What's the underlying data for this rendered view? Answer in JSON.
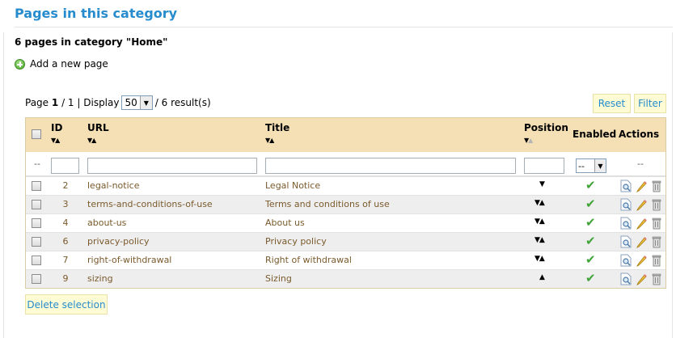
{
  "header": {
    "title": "Pages in this category",
    "count_text": "6 pages in category \"Home\"",
    "add_link": "Add a new page"
  },
  "pager": {
    "page_label": "Page",
    "page_current": "1",
    "page_total_text": "/ 1 | Display",
    "display_value": "50",
    "results_text": "/ 6 result(s)"
  },
  "toolbar": {
    "reset_label": "Reset",
    "filter_label": "Filter"
  },
  "columns": {
    "id": "ID",
    "url": "URL",
    "title": "Title",
    "position": "Position",
    "enabled": "Enabled",
    "actions": "Actions"
  },
  "filters": {
    "dash": "--",
    "enabled_value": "--",
    "actions_dash": "--"
  },
  "rows": [
    {
      "id": "2",
      "url": "legal-notice",
      "title": "Legal Notice",
      "position": "down",
      "enabled": true
    },
    {
      "id": "3",
      "url": "terms-and-conditions-of-use",
      "title": "Terms and conditions of use",
      "position": "both",
      "enabled": true
    },
    {
      "id": "4",
      "url": "about-us",
      "title": "About us",
      "position": "both",
      "enabled": true
    },
    {
      "id": "6",
      "url": "privacy-policy",
      "title": "Privacy policy",
      "position": "both",
      "enabled": true
    },
    {
      "id": "7",
      "url": "right-of-withdrawal",
      "title": "Right of withdrawal",
      "position": "both",
      "enabled": true
    },
    {
      "id": "9",
      "url": "sizing",
      "title": "Sizing",
      "position": "up",
      "enabled": true
    }
  ],
  "footer": {
    "delete_label": "Delete selection"
  },
  "icons": {
    "add": "plus-circle-icon",
    "enabled": "check-icon",
    "view": "view-icon",
    "edit": "pencil-icon",
    "delete": "trash-icon"
  },
  "colors": {
    "accent": "#268ccd",
    "header_bg": "#f5e0b5",
    "button_bg": "#fffbd5",
    "check": "#41a33a"
  }
}
